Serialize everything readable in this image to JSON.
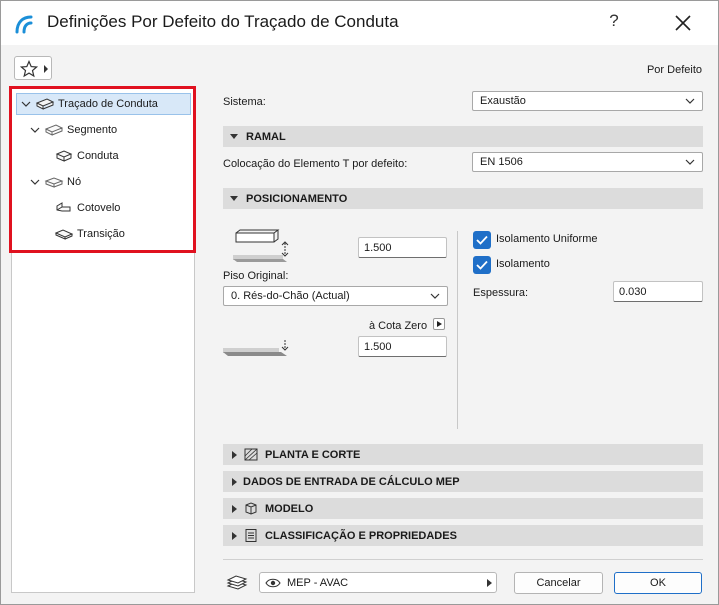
{
  "window": {
    "title": "Definições Por Defeito do Traçado de Conduta",
    "help_label": "?",
    "default_label": "Por Defeito"
  },
  "tree": {
    "items": [
      {
        "label": "Traçado de Conduta",
        "level": 0,
        "expanded": true,
        "selected": true
      },
      {
        "label": "Segmento",
        "level": 1,
        "expanded": true
      },
      {
        "label": "Conduta",
        "level": 2
      },
      {
        "label": "Nó",
        "level": 1,
        "expanded": true
      },
      {
        "label": "Cotovelo",
        "level": 2
      },
      {
        "label": "Transição",
        "level": 2
      }
    ]
  },
  "system": {
    "label": "Sistema:",
    "value": "Exaustão"
  },
  "ramal": {
    "header": "RAMAL",
    "tee_label": "Colocação do Elemento T por defeito:",
    "tee_value": "EN 1506"
  },
  "positioning": {
    "header": "POSICIONAMENTO",
    "height_value": "1.500",
    "home_story_label": "Piso Original:",
    "home_story_value": "0. Rés-do-Chão (Actual)",
    "reference_label": "à Cota Zero",
    "elevation_value": "1.500",
    "uniform_insulation_label": "Isolamento Uniforme",
    "uniform_insulation_checked": true,
    "insulation_label": "Isolamento",
    "insulation_checked": true,
    "thickness_label": "Espessura:",
    "thickness_value": "0.030"
  },
  "collapsed_sections": [
    {
      "label": "PLANTA E CORTE"
    },
    {
      "label": "DADOS DE ENTRADA DE CÁLCULO MEP"
    },
    {
      "label": "MODELO"
    },
    {
      "label": "CLASSIFICAÇÃO E PROPRIEDADES"
    }
  ],
  "footer": {
    "layer_value": "MEP - AVAC",
    "cancel_label": "Cancelar",
    "ok_label": "OK"
  },
  "colors": {
    "accent": "#1f6fc8",
    "highlight_border": "#e0111f",
    "selection_bg": "#d8e8f8"
  }
}
